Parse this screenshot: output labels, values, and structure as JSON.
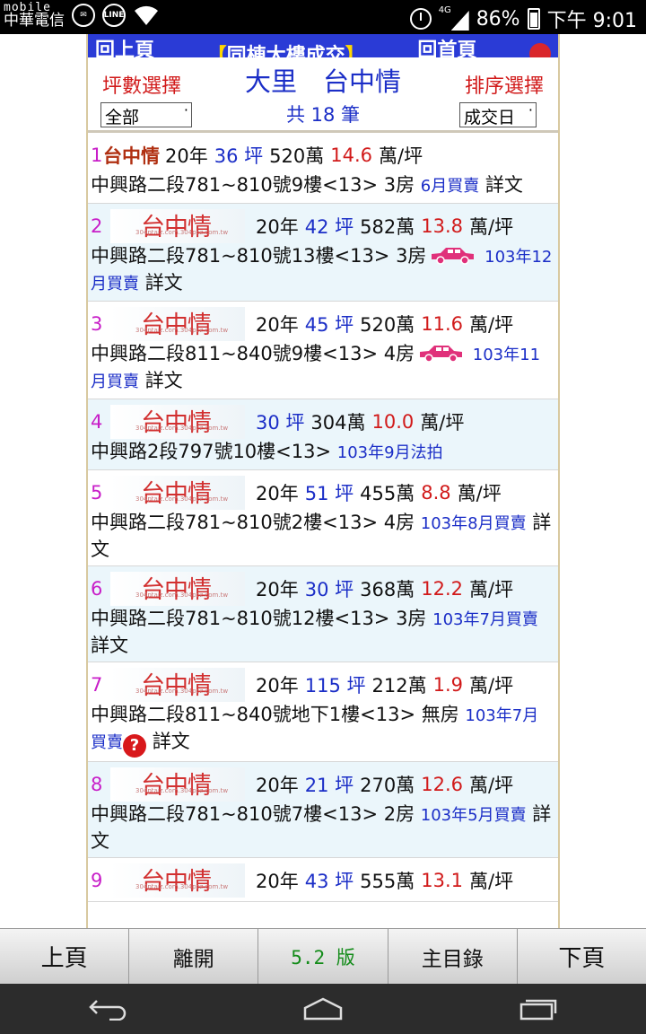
{
  "status_bar": {
    "carrier_line1": "mobile",
    "carrier_line2": "中華電信",
    "app_icon1": "messenger-icon",
    "app_icon2_label": "LINE",
    "battery": "86%",
    "time": "下午 9:01",
    "network": "4G"
  },
  "top_nav": {
    "left": "回上頁",
    "bracket_open": "【",
    "middle": "同棟大樓成交",
    "bracket_close": "】",
    "right": "回首頁"
  },
  "header": {
    "area_label": "坪數選擇",
    "area_value": "全部",
    "title": "大里　台中情",
    "count": "共 18 筆",
    "sort_label": "排序選擇",
    "sort_value": "成交日"
  },
  "logo": {
    "text": "台中情",
    "watermark": "304ptaiz.com.304pcz.com.tw"
  },
  "listings": [
    {
      "num": "1",
      "place": "台中情",
      "show_logo": false,
      "age": "20年",
      "ping": "36 坪",
      "price": "520萬",
      "unit": "14.6",
      "unit_suffix": "萬/坪",
      "address": "中興路二段781~810號9樓<13> 3房",
      "car": false,
      "date": "6月買賣",
      "extra": "",
      "link": "詳文"
    },
    {
      "num": "2",
      "place": "",
      "show_logo": true,
      "age": "20年",
      "ping": "42 坪",
      "price": "582萬",
      "unit": "13.8",
      "unit_suffix": "萬/坪",
      "address": "中興路二段781~810號13樓<13> 3房",
      "car": true,
      "date": "103年12月買賣",
      "extra": "",
      "link": "詳文"
    },
    {
      "num": "3",
      "place": "",
      "show_logo": true,
      "age": "20年",
      "ping": "45 坪",
      "price": "520萬",
      "unit": "11.6",
      "unit_suffix": "萬/坪",
      "address": "中興路二段811~840號9樓<13> 4房",
      "car": true,
      "date": "103年11月買賣",
      "extra": "",
      "link": "詳文"
    },
    {
      "num": "4",
      "place": "",
      "show_logo": true,
      "age": "",
      "ping": "30 坪",
      "price": "304萬",
      "unit": "10.0",
      "unit_suffix": "萬/坪",
      "address": "中興路2段797號10樓<13>",
      "car": false,
      "date": "103年9月法拍",
      "extra": "",
      "link": ""
    },
    {
      "num": "5",
      "place": "",
      "show_logo": true,
      "age": "20年",
      "ping": "51 坪",
      "price": "455萬",
      "unit": "8.8",
      "unit_suffix": "萬/坪",
      "address": "中興路二段781~810號2樓<13> 4房",
      "car": false,
      "date": "103年8月買賣",
      "extra": "",
      "link": "詳文"
    },
    {
      "num": "6",
      "place": "",
      "show_logo": true,
      "age": "20年",
      "ping": "30 坪",
      "price": "368萬",
      "unit": "12.2",
      "unit_suffix": "萬/坪",
      "address": "中興路二段781~810號12樓<13> 3房",
      "car": false,
      "date": "103年7月買賣",
      "extra": "",
      "link": "詳文"
    },
    {
      "num": "7",
      "place": "",
      "show_logo": true,
      "age": "20年",
      "ping": "115 坪",
      "price": "212萬",
      "unit": "1.9",
      "unit_suffix": "萬/坪",
      "address": "中興路二段811~840號地下1樓<13> 無房",
      "car": false,
      "date": "103年7月買賣",
      "extra": "?",
      "link": "詳文"
    },
    {
      "num": "8",
      "place": "",
      "show_logo": true,
      "age": "20年",
      "ping": "21 坪",
      "price": "270萬",
      "unit": "12.6",
      "unit_suffix": "萬/坪",
      "address": "中興路二段781~810號7樓<13> 2房",
      "car": false,
      "date": "103年5月買賣",
      "extra": "",
      "link": "詳文"
    },
    {
      "num": "9",
      "place": "",
      "show_logo": true,
      "age": "20年",
      "ping": "43 坪",
      "price": "555萬",
      "unit": "13.1",
      "unit_suffix": "萬/坪",
      "address": "",
      "car": false,
      "date": "",
      "extra": "",
      "link": ""
    }
  ],
  "toolbar": {
    "prev": "上頁",
    "leave": "離開",
    "version": "5.2 版",
    "menu": "主目錄",
    "next": "下頁"
  },
  "colors": {
    "accent_blue": "#1b2ec7",
    "price_red": "#d11a1a",
    "number_magenta": "#c81ec8",
    "nav_blue": "#2a3bd6",
    "car_pink": "#e0307a",
    "version_green": "#148c1a"
  }
}
